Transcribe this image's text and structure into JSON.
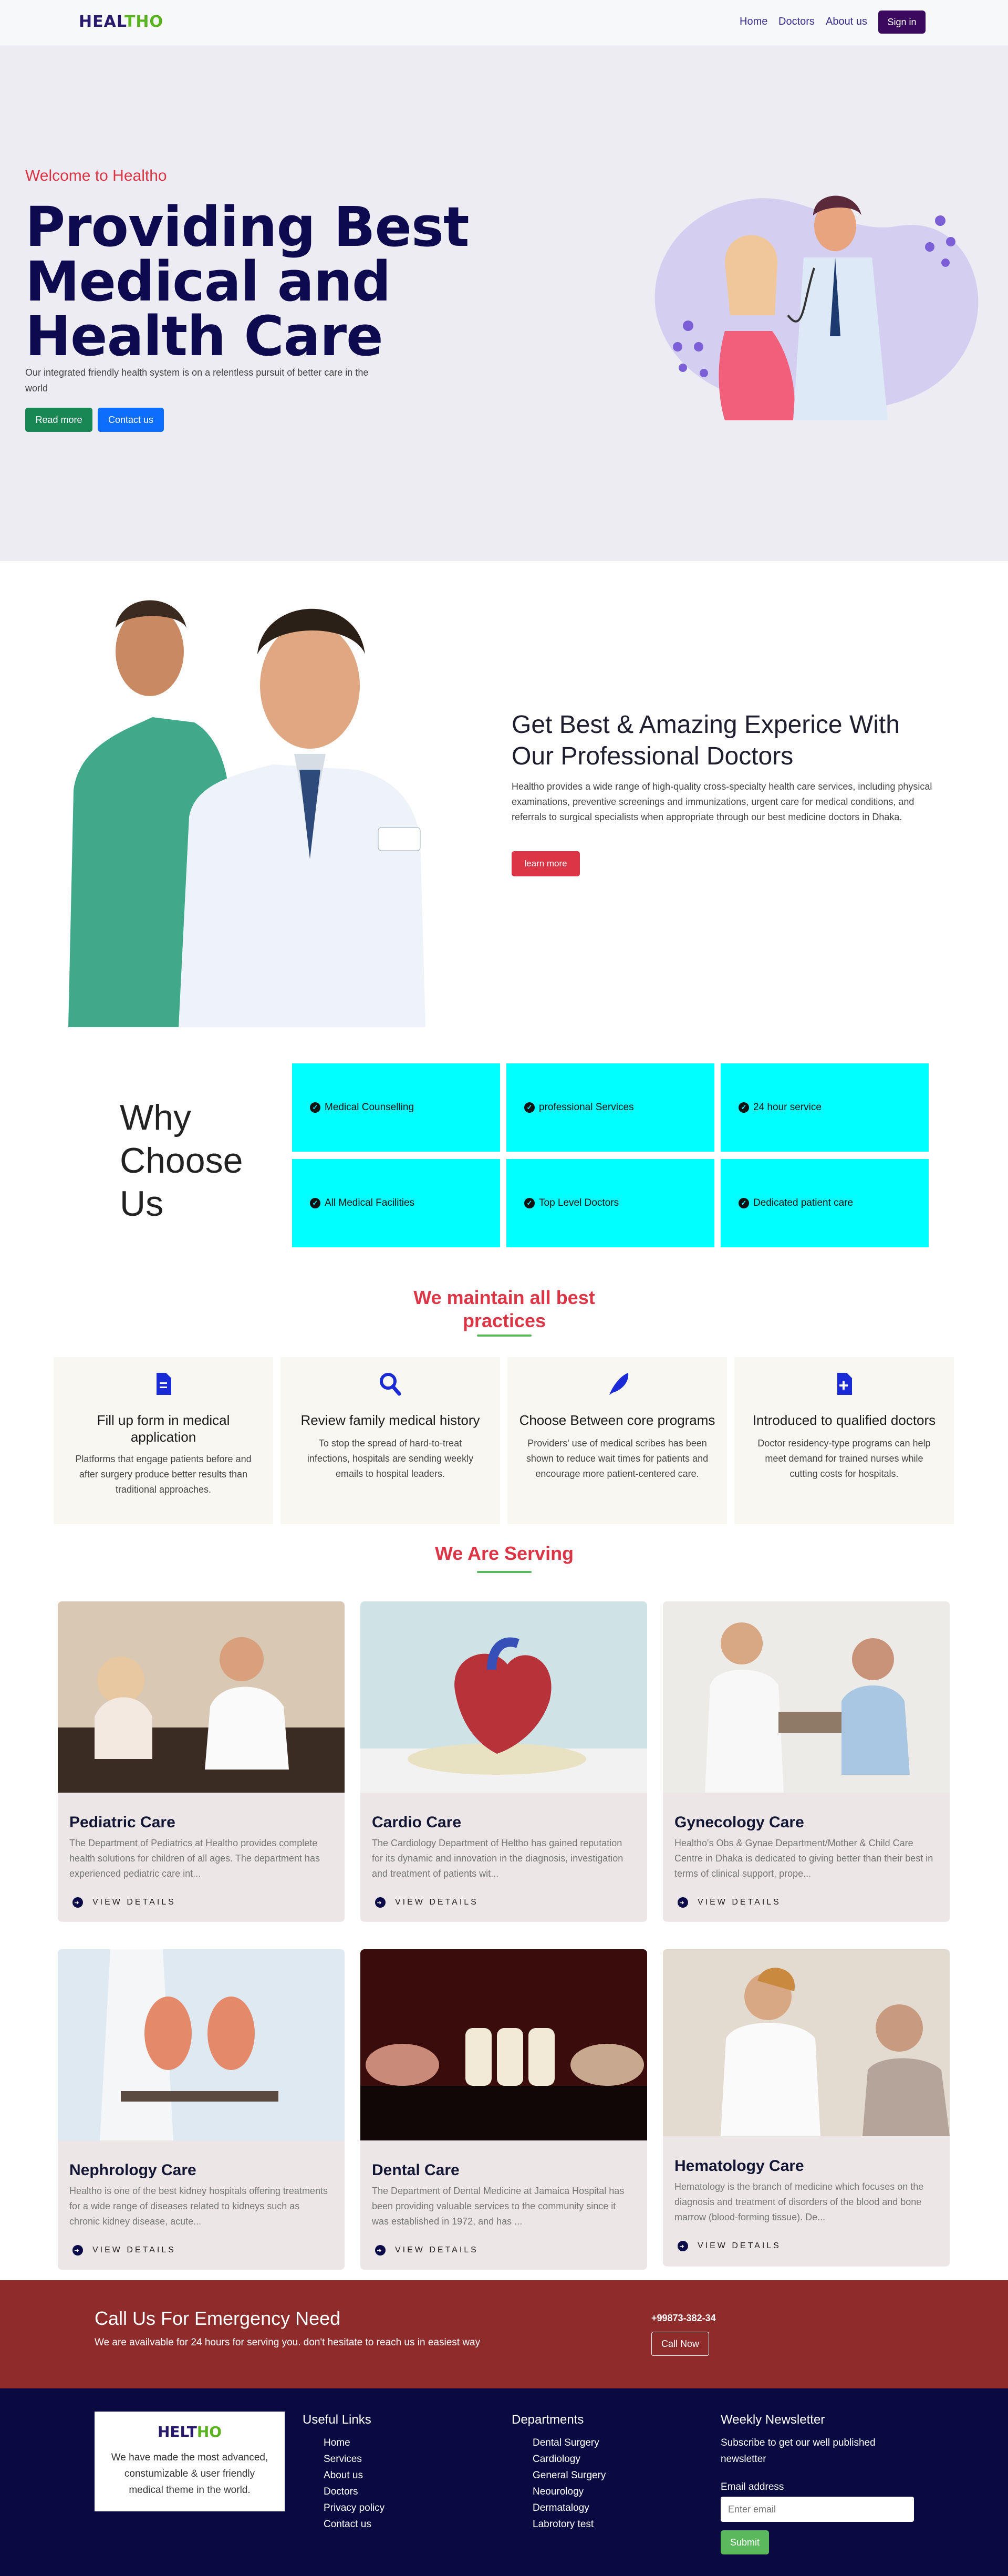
{
  "nav": {
    "logo_a": "HEAL",
    "logo_b": "THO",
    "links": [
      "Home",
      "Doctors",
      "About us"
    ],
    "signin": "Sign in"
  },
  "hero": {
    "welcome": "Welcome to Healtho",
    "title": "Providing Best Medical and Health Care",
    "text": "Our integrated friendly health system is on a relentless pursuit of better care in the world",
    "read_more": "Read more",
    "contact": "Contact us"
  },
  "about": {
    "heading": "Get Best & Amazing Experice With Our Professional Doctors",
    "text": "Healtho provides a wide range of high-quality cross-specialty health care services, including physical examinations, preventive screenings and immunizations, urgent care for medical conditions, and referrals to surgical specialists when appropriate through our best medicine doctors in Dhaka.",
    "button": "learn more"
  },
  "why": {
    "title": "Why Choose Us",
    "items": [
      "Medical Counselling",
      "professional Services",
      "24 hour service",
      "All Medical Facilities",
      "Top Level Doctors",
      "Dedicated patient care"
    ]
  },
  "practices": {
    "heading": "We maintain all best practices",
    "items": [
      {
        "icon": "file-icon",
        "title": "Fill up form in medical application",
        "text": "Platforms that engage patients before and after surgery produce better results than traditional approaches."
      },
      {
        "icon": "search-icon",
        "title": "Review family medical history",
        "text": "To stop the spread of hard-to-treat infections, hospitals are sending weekly emails to hospital leaders."
      },
      {
        "icon": "feather-icon",
        "title": "Choose Between core programs",
        "text": "Providers' use of medical scribes has been shown to reduce wait times for patients and encourage more patient-centered care."
      },
      {
        "icon": "medical-file-icon",
        "title": "Introduced to qualified doctors",
        "text": "Doctor residency-type programs can help meet demand for trained nurses while cutting costs for hospitals."
      }
    ]
  },
  "serving": {
    "heading": "We Are Serving",
    "view": "VIEW DETAILS",
    "cards": [
      {
        "title": "Pediatric Care",
        "text": "The Department of Pediatrics at Healtho provides complete health solutions for children of all ages. The department has experienced pediatric care int..."
      },
      {
        "title": "Cardio Care",
        "text": "The Cardiology Department of Heltho has gained reputation for its dynamic and innovation in the diagnosis, investigation and treatment of patients wit..."
      },
      {
        "title": "Gynecology Care",
        "text": "Healtho's Obs & Gynae Department/Mother & Child Care Centre in Dhaka is dedicated to giving better than their best in terms of clinical support, prope..."
      },
      {
        "title": "Nephrology Care",
        "text": "Healtho is one of the best kidney hospitals offering treatments for a wide range of diseases related to kidneys such as chronic kidney disease, acute..."
      },
      {
        "title": "Dental Care",
        "text": "The Department of Dental Medicine at Jamaica Hospital has been providing valuable services to the community since it was established in 1972, and has ..."
      },
      {
        "title": "Hematology Care",
        "text": "Hematology is the branch of medicine which focuses on the diagnosis and treatment of disorders of the blood and bone marrow (blood-forming tissue). De..."
      }
    ]
  },
  "emergency": {
    "title": "Call Us For Emergency Need",
    "text": "We are availvable for 24 hours for serving you. don't hesitate to reach us in easiest way",
    "phone": "+99873-382-34",
    "button": "Call Now"
  },
  "footer": {
    "logo_a": "HELT",
    "logo_b": "HO",
    "about": "We have made the most advanced, constumizable & user friendly medical theme in the world.",
    "useful_title": "Useful Links",
    "useful": [
      "Home",
      "Services",
      "About us",
      "Doctors",
      "Privacy policy",
      "Contact us"
    ],
    "dept_title": "Departments",
    "depts": [
      "Dental Surgery",
      "Cardiology",
      "General Surgery",
      "Neourology",
      "Dermatalogy",
      "Labrotory test"
    ],
    "news_title": "Weekly Newsletter",
    "news_text": "Subscribe to get our well published newsletter",
    "email_label": "Email address",
    "email_placeholder": "Enter email",
    "submit": "Submit"
  },
  "colors": {
    "accent": "#dc3545",
    "navy": "#0d0a4f",
    "cyan": "#00ffff",
    "green": "#5ab31f",
    "emergency": "#8e2b2b",
    "footer": "#0a0a42"
  }
}
